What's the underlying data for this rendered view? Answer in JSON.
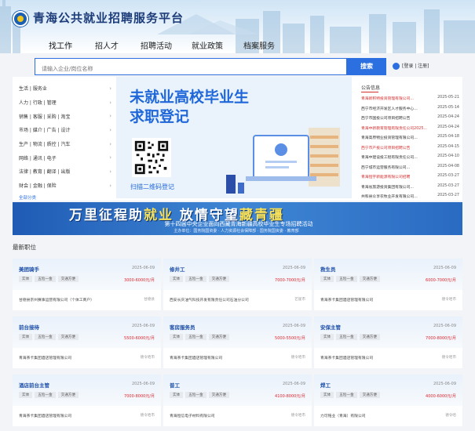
{
  "header": {
    "site_title": "青海公共就业招聘服务平台",
    "nav": [
      "找工作",
      "招人才",
      "招聘活动",
      "就业政策",
      "档案服务"
    ]
  },
  "search": {
    "placeholder": "请输入企业/岗位名称",
    "button_label": "搜索",
    "login_label": "[登录 | 注册]"
  },
  "categories": {
    "rows": [
      "生活 | 服务业",
      "人力 | 行政 | 管理",
      "销售 | 客服 | 采购 | 淘宝",
      "市场 | 媒介 | 广告 | 设计",
      "生产 | 物流 | 质控 | 汽车",
      "网络 | 通讯 | 电子",
      "法律 | 教育 | 翻译 | 出版",
      "财会 | 金融 | 保险"
    ],
    "all_label": "全部分类"
  },
  "banner": {
    "title_line1": "未就业高校毕业生",
    "title_line2": "求职登记",
    "qr_label": "扫描二维码登记"
  },
  "notice": {
    "title": "公告信息",
    "items": [
      {
        "title": "青海新积特投资管理有限公司...",
        "date": "2025-05-21",
        "color": "#d32f2f"
      },
      {
        "title": "西宁市经济开发区人才服务中心...",
        "date": "2025-05-14",
        "color": "#333333"
      },
      {
        "title": "西宁市国投公司项目招聘公告",
        "date": "2025-04-24",
        "color": "#333333"
      },
      {
        "title": "青海中新教育管理有限责任公司2025...",
        "date": "2025-04-24",
        "color": "#d32f2f"
      },
      {
        "title": "青海高原物业投资管理有限公司...",
        "date": "2025-04-18",
        "color": "#333333"
      },
      {
        "title": "西宁市产投公司项目招聘公告",
        "date": "2025-04-15",
        "color": "#d32f2f"
      },
      {
        "title": "青海中建设投工程有限责任公司...",
        "date": "2025-04-10",
        "color": "#333333"
      },
      {
        "title": "西宁城市运营服务有限公司...",
        "date": "2025-04-08",
        "color": "#333333"
      },
      {
        "title": "青海恒宇新能源有限公司招聘",
        "date": "2025-03-27",
        "color": "#d32f2f"
      },
      {
        "title": "青海省旅游投资集团有限公司...",
        "date": "2025-03-27",
        "color": "#333333"
      },
      {
        "title": "共和县众享农牧业开发有限公司...",
        "date": "2025-03-27",
        "color": "#333333"
      },
      {
        "title": "青海万厦建设工程有限公司...",
        "date": "2025-03-17",
        "color": "#333333"
      }
    ]
  },
  "strip": {
    "text_a": "万里征程助",
    "text_b": "就业",
    "text_c": " 放情守望",
    "text_d": "藏青疆",
    "subtitle": "第十四届中央企业面向西藏青海新疆高校毕业生专场招聘活动",
    "subtitle2": "主办单位：国务院国资委 · 人力资源社会保障部 · 国务院国资委 · 教育部"
  },
  "jobs": {
    "section_title": "最新职位",
    "cards": [
      {
        "title": "美团骑手",
        "date": "2025-06-09",
        "tags": [
          "实体",
          "五险一金",
          "交通方便"
        ],
        "salary": "3000-6000元/月",
        "company": "甘德县京州赛事运营有限公司（个体工商户）",
        "city": "甘德县"
      },
      {
        "title": "修井工",
        "date": "2025-06-09",
        "tags": [
          "实体",
          "五险一金",
          "交通方便"
        ],
        "salary": "7000-7000元/月",
        "company": "西安长庆油气科技开发有限责任公司石油分公司",
        "city": "芒崖市"
      },
      {
        "title": "救生员",
        "date": "2025-06-09",
        "tags": [
          "实体",
          "五险一金",
          "交通方便"
        ],
        "salary": "6000-7000元/月",
        "company": "青海茶卡集团酒店管理有限公司",
        "city": "德令哈市"
      },
      {
        "title": "前台接待",
        "date": "2025-06-09",
        "tags": [
          "实体",
          "五险一金",
          "交通方便"
        ],
        "salary": "5500-6000元/月",
        "company": "青海茶卡集团酒店管理有限公司",
        "city": "德令哈市"
      },
      {
        "title": "客房服务员",
        "date": "2025-06-09",
        "tags": [
          "实体",
          "五险一金",
          "交通方便"
        ],
        "salary": "5000-5500元/月",
        "company": "青海茶卡集团酒店管理有限公司",
        "city": "德令哈市"
      },
      {
        "title": "安保主管",
        "date": "2025-06-09",
        "tags": [
          "实体",
          "五险一金",
          "交通方便"
        ],
        "salary": "7000-8000元/月",
        "company": "青海茶卡集团酒店管理有限公司",
        "city": "德令哈市"
      },
      {
        "title": "酒店前台主管",
        "date": "2025-06-09",
        "tags": [
          "实体",
          "五险一金",
          "交通方便"
        ],
        "salary": "7000-8000元/月",
        "company": "青海茶卡集团酒店管理有限公司",
        "city": "德令哈市"
      },
      {
        "title": "普工",
        "date": "2025-06-09",
        "tags": [
          "实体",
          "五险一金",
          "交通方便"
        ],
        "salary": "4100-8000元/月",
        "company": "青海恒信电子材料有限公司",
        "city": "德令哈市"
      },
      {
        "title": "焊工",
        "date": "2025-06-09",
        "tags": [
          "实体",
          "五险一金",
          "交通方便"
        ],
        "salary": "4000-6000元/月",
        "company": "力可锆业（青海）有限公司",
        "city": "德令哈"
      }
    ]
  }
}
